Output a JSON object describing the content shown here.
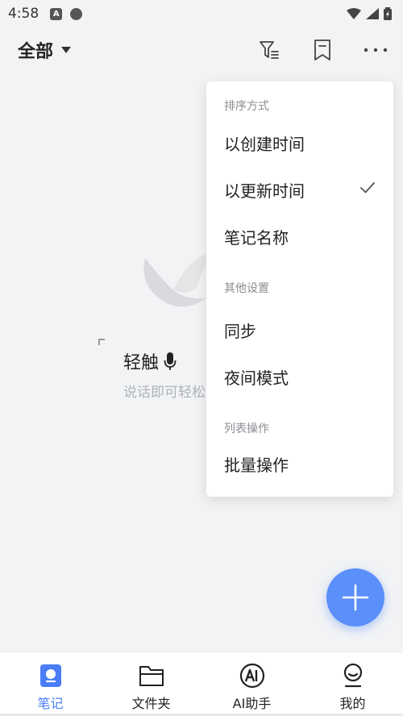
{
  "status_bar": {
    "time": "4:58",
    "notif_a": "A"
  },
  "header": {
    "filter_label": "全部"
  },
  "empty_state": {
    "title": "轻触",
    "subtitle": "说话即可轻松"
  },
  "menu": {
    "sections": [
      {
        "title": "排序方式",
        "items": [
          "以创建时间",
          "以更新时间",
          "笔记名称"
        ]
      },
      {
        "title": "其他设置",
        "items": [
          "同步",
          "夜间模式"
        ]
      },
      {
        "title": "列表操作",
        "items": [
          "批量操作"
        ]
      }
    ],
    "checked_item": "以更新时间"
  },
  "bottom_nav": {
    "items": [
      {
        "label": "笔记",
        "icon": "notes-icon",
        "active": true
      },
      {
        "label": "文件夹",
        "icon": "folder-icon",
        "active": false
      },
      {
        "label": "AI助手",
        "icon": "ai-assistant-icon",
        "active": false
      },
      {
        "label": "我的",
        "icon": "profile-icon",
        "active": false
      }
    ]
  },
  "colors": {
    "accent": "#5b8ff9",
    "nav_active": "#4a7df6",
    "background": "#f2f3f5"
  }
}
